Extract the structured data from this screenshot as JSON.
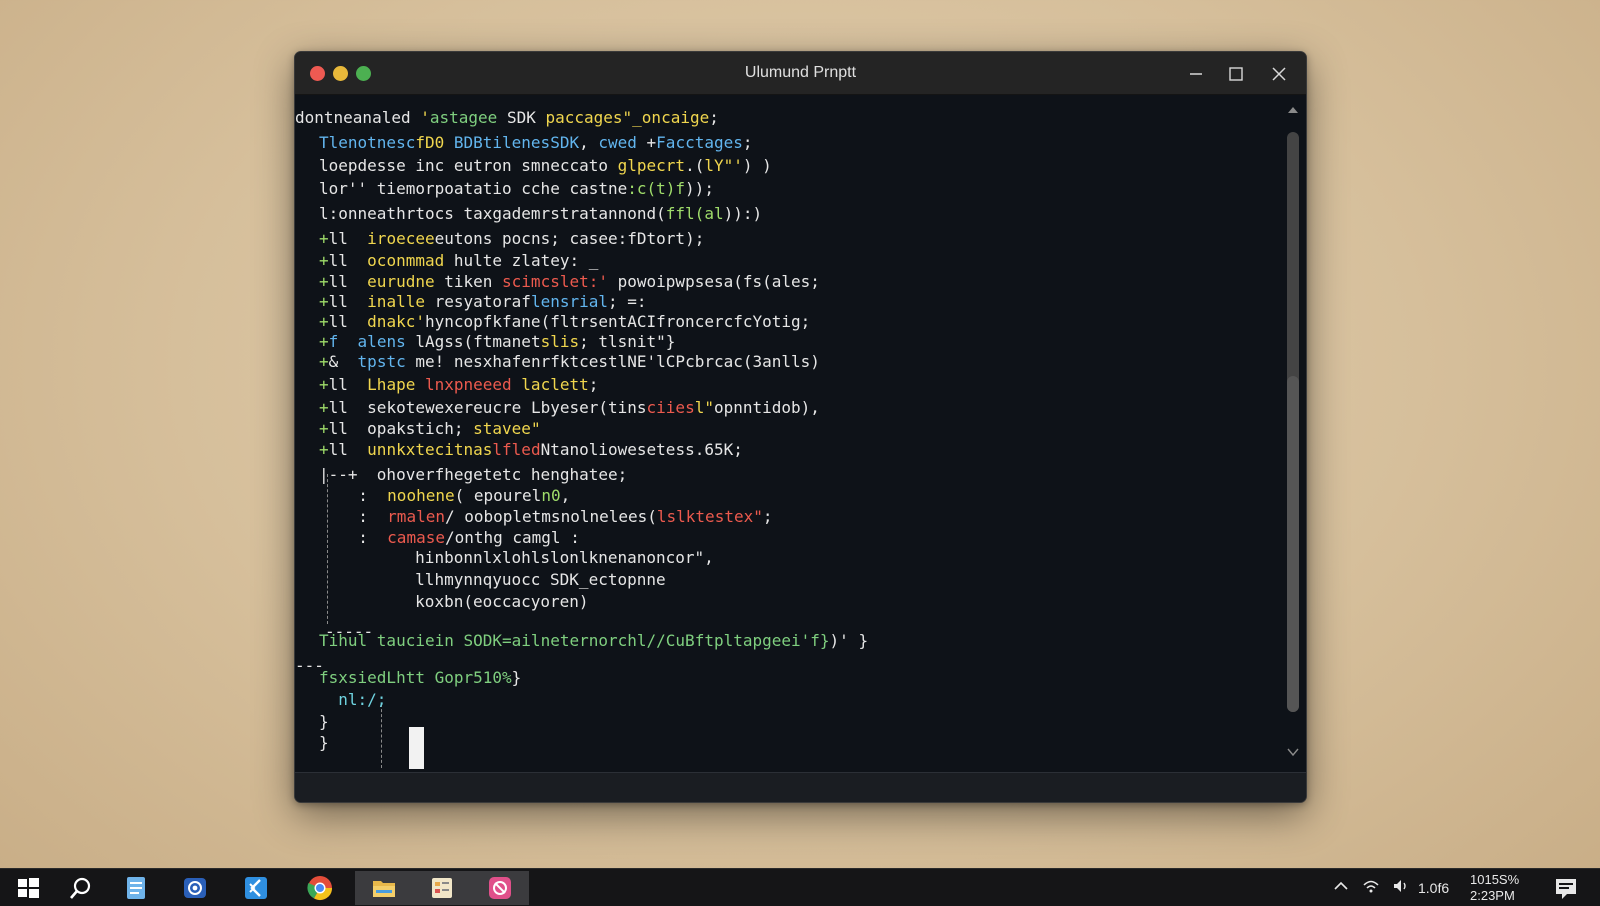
{
  "window": {
    "title": "Ulumund Prnptt"
  },
  "terminal": {
    "lines": [
      [
        {
          "t": "dontneanaled ",
          "c": "w"
        },
        {
          "t": "'",
          "c": "y"
        },
        {
          "t": "astagee ",
          "c": "gl"
        },
        {
          "t": "SDK ",
          "c": "w"
        },
        {
          "t": "paccages\"_oncaige",
          "c": "y"
        },
        {
          "t": ";",
          "c": "w"
        }
      ],
      [
        {
          "t": "Tlenotnesc",
          "c": "b"
        },
        {
          "t": "fD0 ",
          "c": "y"
        },
        {
          "t": "BDBtilenesSDK",
          "c": "b"
        },
        {
          "t": ", ",
          "c": "w"
        },
        {
          "t": "cwed ",
          "c": "b"
        },
        {
          "t": "+",
          "c": "w"
        },
        {
          "t": "Facctages",
          "c": "b"
        },
        {
          "t": ";",
          "c": "w"
        }
      ],
      [
        {
          "t": "loepdesse ",
          "c": "w"
        },
        {
          "t": "inc ",
          "c": "w"
        },
        {
          "t": "eutron ",
          "c": "w"
        },
        {
          "t": "smneccato ",
          "c": "w"
        },
        {
          "t": "glpecrt",
          "c": "y"
        },
        {
          "t": ".(",
          "c": "w"
        },
        {
          "t": "lY\"'",
          "c": "y"
        },
        {
          "t": ") )",
          "c": "w"
        }
      ],
      [
        {
          "t": "lor'' tiemorpoatatio cche castne",
          "c": "w"
        },
        {
          "t": ":c(t)f",
          "c": "g"
        },
        {
          "t": "));",
          "c": "w"
        }
      ],
      [
        {
          "t": "l:onneathr",
          "c": "w"
        },
        {
          "t": "tocs taxgademrstratannond(",
          "c": "w"
        },
        {
          "t": "ffl(al",
          "c": "g"
        },
        {
          "t": ")):)",
          "c": "w"
        }
      ],
      [
        {
          "t": "+",
          "c": "g"
        },
        {
          "t": "ll  ",
          "c": "w"
        },
        {
          "t": "iroecee",
          "c": "y"
        },
        {
          "t": "eutons pocns; casee:fDtort);",
          "c": "w"
        }
      ],
      [
        {
          "t": "+",
          "c": "g"
        },
        {
          "t": "ll  ",
          "c": "w"
        },
        {
          "t": "oconmmad ",
          "c": "y"
        },
        {
          "t": "hulte zlatey: _",
          "c": "w"
        }
      ],
      [
        {
          "t": "+",
          "c": "g"
        },
        {
          "t": "ll  ",
          "c": "w"
        },
        {
          "t": "eurudne ",
          "c": "y"
        },
        {
          "t": "tiken ",
          "c": "w"
        },
        {
          "t": "scimcslet:'",
          "c": "r"
        },
        {
          "t": " powoipwpsesa(fs(ales;",
          "c": "w"
        }
      ],
      [
        {
          "t": "+",
          "c": "g"
        },
        {
          "t": "ll  ",
          "c": "w"
        },
        {
          "t": "inalle ",
          "c": "y"
        },
        {
          "t": "resyatoraf",
          "c": "w"
        },
        {
          "t": "lensrial",
          "c": "b"
        },
        {
          "t": "; =:",
          "c": "w"
        }
      ],
      [
        {
          "t": "+",
          "c": "g"
        },
        {
          "t": "ll  ",
          "c": "w"
        },
        {
          "t": "dnakc'",
          "c": "y"
        },
        {
          "t": "hyncopfkfane(fltrsentACIfroncerc",
          "c": "w"
        },
        {
          "t": "fcYotig;",
          "c": "w"
        }
      ],
      [
        {
          "t": "+",
          "c": "g"
        },
        {
          "t": "f  ",
          "c": "b"
        },
        {
          "t": "alens ",
          "c": "b"
        },
        {
          "t": "lAgss(ftmanet",
          "c": "w"
        },
        {
          "t": "slis",
          "c": "y"
        },
        {
          "t": "; tlsnit\"}",
          "c": "w"
        }
      ],
      [
        {
          "t": "+",
          "c": "g"
        },
        {
          "t": "&  ",
          "c": "w"
        },
        {
          "t": "tpstc ",
          "c": "b"
        },
        {
          "t": "me! nesxhafenrfktcestlNE'lCP",
          "c": "w"
        },
        {
          "t": "cbrcac(3anlls)",
          "c": "w"
        }
      ],
      [
        {
          "t": "+",
          "c": "g"
        },
        {
          "t": "ll  ",
          "c": "w"
        },
        {
          "t": "Lhape ",
          "c": "y"
        },
        {
          "t": "lnxpneeed ",
          "c": "r"
        },
        {
          "t": "laclett",
          "c": "y"
        },
        {
          "t": ";",
          "c": "w"
        }
      ],
      [
        {
          "t": "+",
          "c": "g"
        },
        {
          "t": "ll  ",
          "c": "w"
        },
        {
          "t": "sekotewexereucre ",
          "c": "w"
        },
        {
          "t": "Lbyeser(tins",
          "c": "w"
        },
        {
          "t": "ciies",
          "c": "r"
        },
        {
          "t": "l\"",
          "c": "y"
        },
        {
          "t": "opnntidob),",
          "c": "w"
        }
      ],
      [
        {
          "t": "+",
          "c": "g"
        },
        {
          "t": "ll  ",
          "c": "w"
        },
        {
          "t": "opakstich; ",
          "c": "w"
        },
        {
          "t": "stavee\"",
          "c": "y"
        }
      ],
      [
        {
          "t": "+",
          "c": "g"
        },
        {
          "t": "ll  ",
          "c": "w"
        },
        {
          "t": "unnkxtecitnas",
          "c": "y"
        },
        {
          "t": "lfled",
          "c": "r"
        },
        {
          "t": "Ntanoliowesetess.65K;",
          "c": "w"
        }
      ],
      [
        {
          "t": "|--+  ",
          "c": "w"
        },
        {
          "t": "ohoverfhegetetc ",
          "c": "w"
        },
        {
          "t": "henghatee;",
          "c": "w"
        }
      ],
      [
        {
          "t": "  :  ",
          "c": "w"
        },
        {
          "t": "noohene",
          "c": "y"
        },
        {
          "t": "( epourel",
          "c": "w"
        },
        {
          "t": "n0",
          "c": "g"
        },
        {
          "t": ",",
          "c": "w"
        }
      ],
      [
        {
          "t": "  :  ",
          "c": "w"
        },
        {
          "t": "rmalen",
          "c": "r"
        },
        {
          "t": "/ oobopletmsnolnelees(",
          "c": "w"
        },
        {
          "t": "lslktestex\"",
          "c": "r"
        },
        {
          "t": ";",
          "c": "w"
        }
      ],
      [
        {
          "t": "  :  ",
          "c": "w"
        },
        {
          "t": "camase",
          "c": "r"
        },
        {
          "t": "/onthg camgl :",
          "c": "w"
        }
      ],
      [
        {
          "t": "     ",
          "c": "w"
        },
        {
          "t": "hinbonnlxlohlslonlknenanoncor\",",
          "c": "w"
        }
      ],
      [
        {
          "t": "     ",
          "c": "w"
        },
        {
          "t": "llhmynnqyuocc ",
          "c": "w"
        },
        {
          "t": "SDK_ectopnne",
          "c": "w"
        }
      ],
      [
        {
          "t": "     ",
          "c": "w"
        },
        {
          "t": "koxbn(eoccacyoren)",
          "c": "w"
        }
      ],
      [
        {
          "t": "Tihul ",
          "c": "gl"
        },
        {
          "t": "tauciein ",
          "c": "gl"
        },
        {
          "t": "SODK=ailneternorchl//CuBftpltapgeei'f}",
          "c": "gl"
        },
        {
          "t": ")' }",
          "c": "w"
        }
      ],
      [
        {
          "t": "fsxsiedLhtt ",
          "c": "gl"
        },
        {
          "t": "Gopr510%",
          "c": "gl"
        },
        {
          "t": "}",
          "c": "w"
        }
      ],
      [
        {
          "t": "  nl:/;",
          "c": "c"
        }
      ],
      [
        {
          "t": "}",
          "c": "w"
        }
      ],
      [
        {
          "t": "}",
          "c": "w"
        }
      ]
    ],
    "separators": [
      "-----",
      "---"
    ]
  },
  "taskbar": {
    "icons": [
      {
        "name": "windows-start-icon",
        "color": "#ffffff"
      },
      {
        "name": "search-icon",
        "color": "#ffffff"
      },
      {
        "name": "notepad-icon",
        "color": "#6fb3ea"
      },
      {
        "name": "camera-app-icon",
        "color": "#3a7bd5"
      },
      {
        "name": "vscode-icon",
        "color": "#2f8fe0"
      },
      {
        "name": "chrome-icon",
        "color": "#e44d3a"
      },
      {
        "name": "file-explorer-icon",
        "color": "#e8b84a"
      },
      {
        "name": "task-manager-icon",
        "color": "#e8a84a"
      },
      {
        "name": "feedback-hub-icon",
        "color": "#e0508a"
      }
    ],
    "tray": {
      "network_value": "1.0f6",
      "clock_time": "1015S%",
      "clock_date": "2:23PM"
    }
  }
}
